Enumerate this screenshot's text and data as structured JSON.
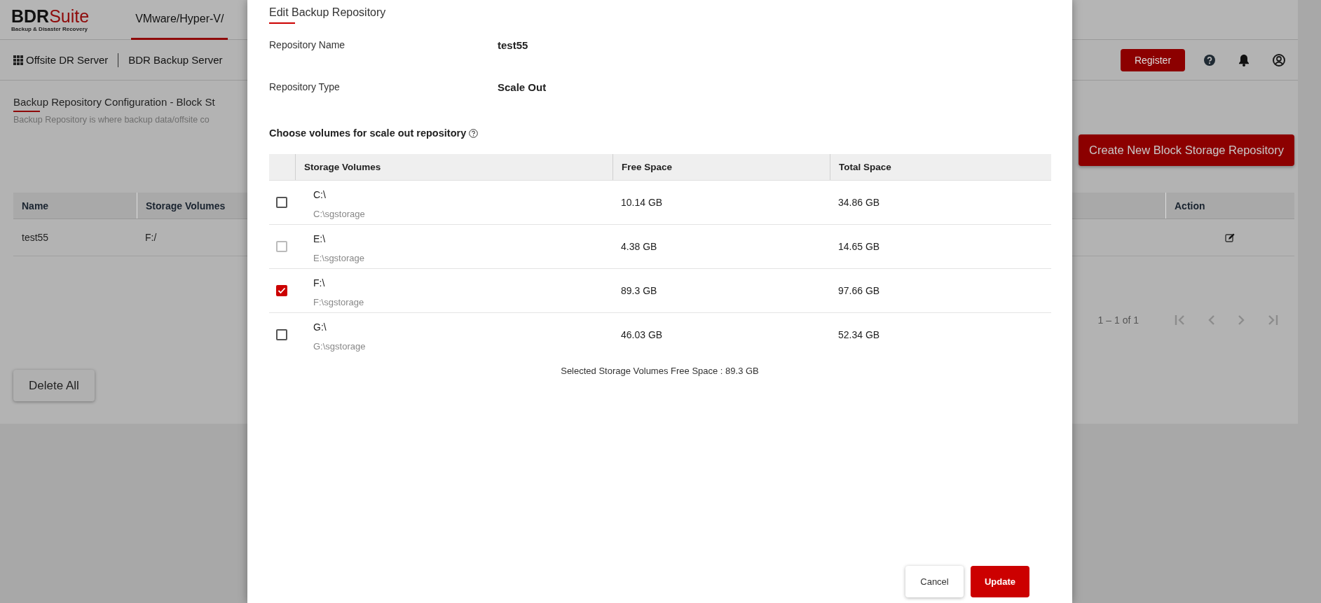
{
  "header": {
    "logo": {
      "brand": "BDR",
      "brand_accent": "Suite",
      "tagline": "Backup & Disaster Recovery"
    },
    "tabs": [
      {
        "label": "VMware/Hyper-V/",
        "selected": true
      }
    ],
    "register_button": "Register"
  },
  "breadcrumb": [
    "Offsite DR Server",
    "BDR Backup Server"
  ],
  "page": {
    "title": "Backup Repository Configuration - Block St",
    "subtitle": "Backup Repository is where backup data/offsite co",
    "create_button": "Create New Block Storage Repository",
    "table": {
      "columns": [
        "Name",
        "Storage Volumes",
        "Action"
      ],
      "rows": [
        {
          "name": "test55",
          "storage_volumes": "F:/"
        }
      ]
    },
    "pagination": "1 – 1 of 1",
    "delete_button": "Delete All"
  },
  "dialog": {
    "title": "Edit Backup Repository",
    "fields": [
      {
        "label": "Repository Name",
        "value": "test55"
      },
      {
        "label": "Repository Type",
        "value": "Scale Out"
      }
    ],
    "volumes_heading": "Choose volumes for scale out repository",
    "table": {
      "columns": [
        "Storage Volumes",
        "Free Space",
        "Total Space"
      ],
      "rows": [
        {
          "volume": "C:\\",
          "path": "C:\\sgstorage",
          "free_space": "10.14 GB",
          "total_space": "34.86 GB",
          "checked": false,
          "disabled": false
        },
        {
          "volume": "E:\\",
          "path": "E:\\sgstorage",
          "free_space": "4.38 GB",
          "total_space": "14.65 GB",
          "checked": false,
          "disabled": true
        },
        {
          "volume": "F:\\",
          "path": "F:\\sgstorage",
          "free_space": "89.3 GB",
          "total_space": "97.66 GB",
          "checked": true,
          "disabled": false
        },
        {
          "volume": "G:\\",
          "path": "G:\\sgstorage",
          "free_space": "46.03 GB",
          "total_space": "52.34 GB",
          "checked": false,
          "disabled": false
        }
      ]
    },
    "summary": "Selected Storage Volumes Free Space : 89.3 GB",
    "buttons": [
      {
        "label": "Cancel",
        "kind": "secondary"
      },
      {
        "label": "Update",
        "kind": "primary"
      }
    ]
  }
}
